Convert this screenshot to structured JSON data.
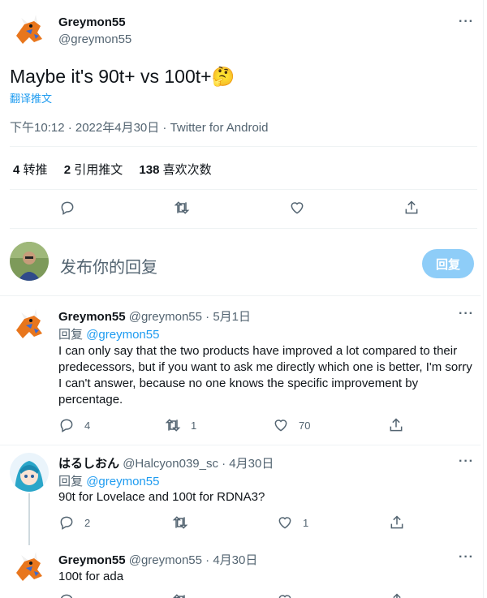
{
  "main_tweet": {
    "name": "Greymon55",
    "handle": "@greymon55",
    "text": "Maybe it's 90t+ vs 100t+",
    "emoji": "🤔",
    "translate": "翻译推文",
    "timestamp": "下午10:12 · 2022年4月30日 · Twitter for Android",
    "stats": {
      "retweets_num": "4",
      "retweets_label": "转推",
      "quotes_num": "2",
      "quotes_label": "引用推文",
      "likes_num": "138",
      "likes_label": "喜欢次数"
    }
  },
  "reply_box": {
    "placeholder": "发布你的回复",
    "button": "回复"
  },
  "replies": [
    {
      "name": "Greymon55",
      "meta": "@greymon55 · 5月1日",
      "reply_prefix": "回复",
      "reply_to": "@greymon55",
      "text": "I can only say that the two products have improved a lot compared to their predecessors, but if you want to ask me directly which one is better, I'm sorry I can't answer, because no one knows the specific improvement by percentage.",
      "replies": "4",
      "retweets": "1",
      "likes": "70"
    },
    {
      "name": "はるしおん",
      "meta": "@Halcyon039_sc · 4月30日",
      "reply_prefix": "回复",
      "reply_to": "@greymon55",
      "text": "90t for Lovelace and 100t for RDNA3?",
      "replies": "2",
      "retweets": "",
      "likes": "1"
    },
    {
      "name": "Greymon55",
      "meta": "@greymon55 · 4月30日",
      "text": "100t for ada"
    }
  ],
  "colors": {
    "accent": "#1d9bf0",
    "muted": "#536471",
    "reply_button": "#8ecdf8"
  }
}
